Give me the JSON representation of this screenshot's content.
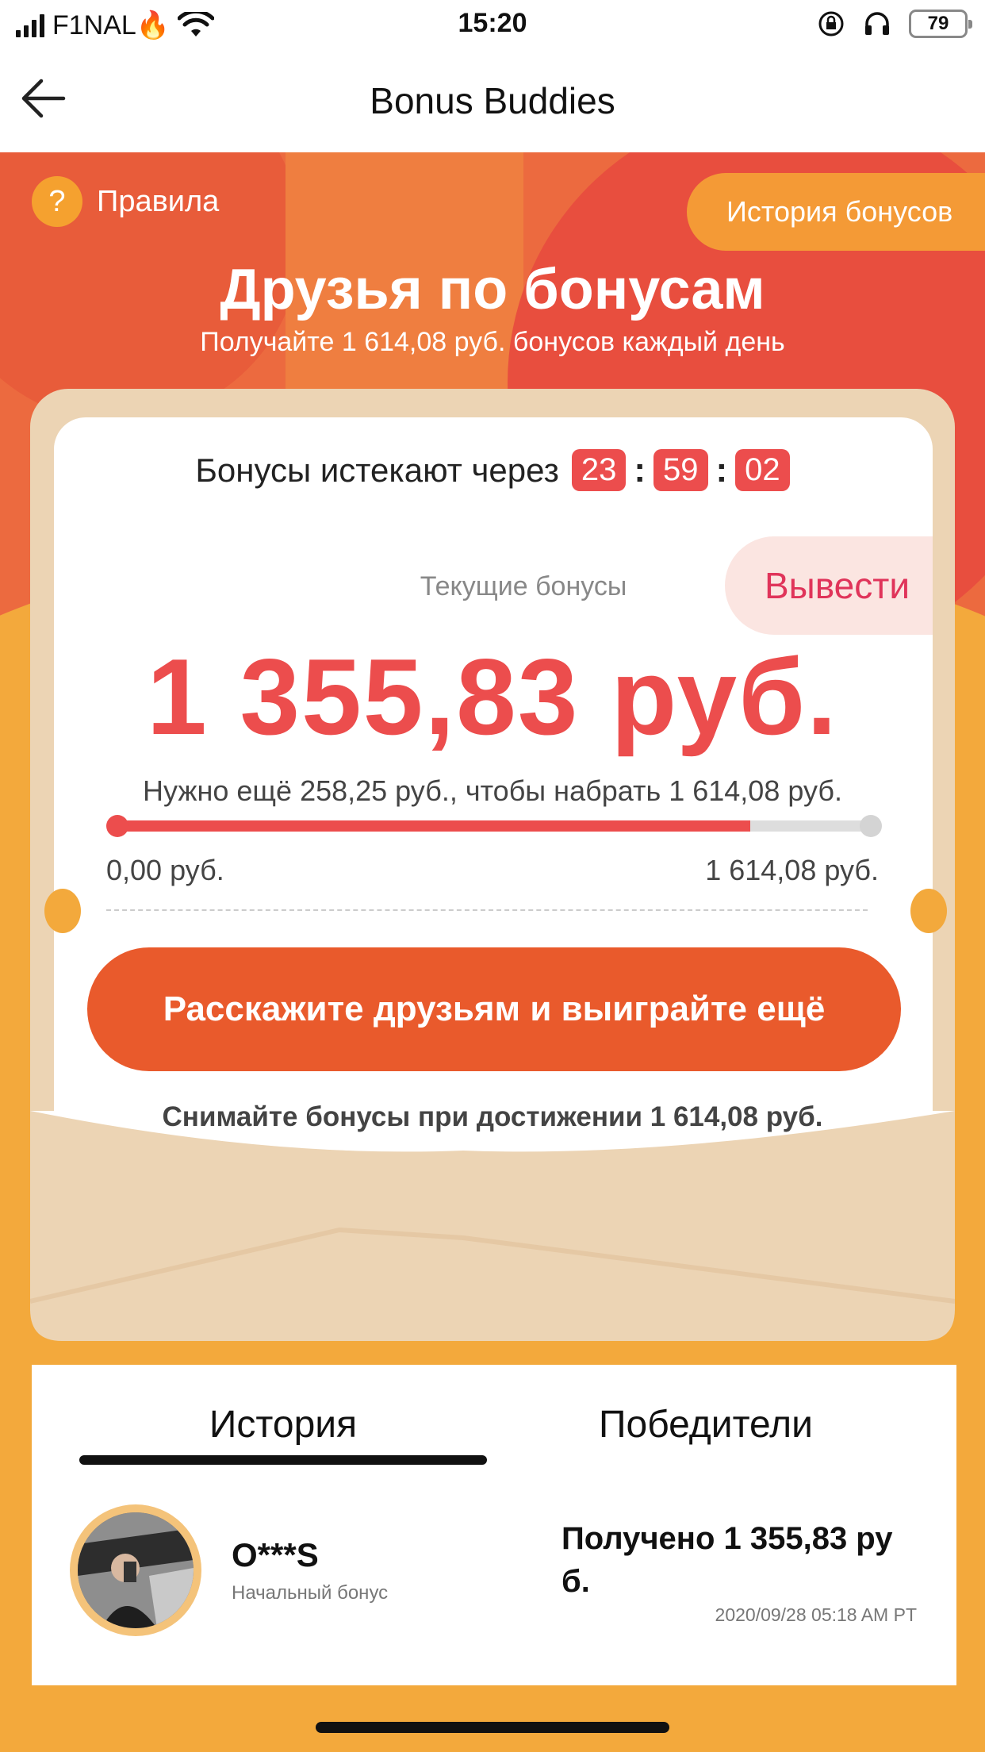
{
  "status_bar": {
    "carrier": "F1NAL🔥",
    "time": "15:20",
    "battery": "79"
  },
  "nav": {
    "title": "Bonus Buddies"
  },
  "hero": {
    "rules_label": "Правила",
    "rules_icon": "?",
    "history_button": "История бонусов",
    "title": "Друзья по бонусам",
    "subtitle": "Получайте 1 614,08 руб. бонусов каждый день"
  },
  "card": {
    "timer_label": "Бонусы истекают через",
    "timer": {
      "hours": "23",
      "minutes": "59",
      "seconds": "02"
    },
    "current_label": "Текущие бонусы",
    "withdraw_button": "Вывести",
    "amount": "1 355,83 руб.",
    "need_text": "Нужно ещё 258,25 руб., чтобы набрать 1 614,08 руб.",
    "progress_fraction": 0.84,
    "min_label": "0,00 руб.",
    "max_label": "1 614,08 руб.",
    "share_button": "Расскажите друзьям и выиграйте ещё",
    "note": "Снимайте бонусы при достижении 1 614,08 руб."
  },
  "history": {
    "tabs": [
      {
        "label": "История",
        "active": true
      },
      {
        "label": "Победители",
        "active": false
      }
    ],
    "items": [
      {
        "name": "O***S",
        "subtitle": "Начальный бонус",
        "received": "Получено 1 355,83 ру б.",
        "timestamp": "2020/09/28 05:18 AM PT"
      }
    ]
  },
  "colors": {
    "accent_red": "#ec4d4d",
    "button_orange": "#e95a2c",
    "background_orange": "#f3a93c",
    "envelope": "#ecd4b4"
  }
}
